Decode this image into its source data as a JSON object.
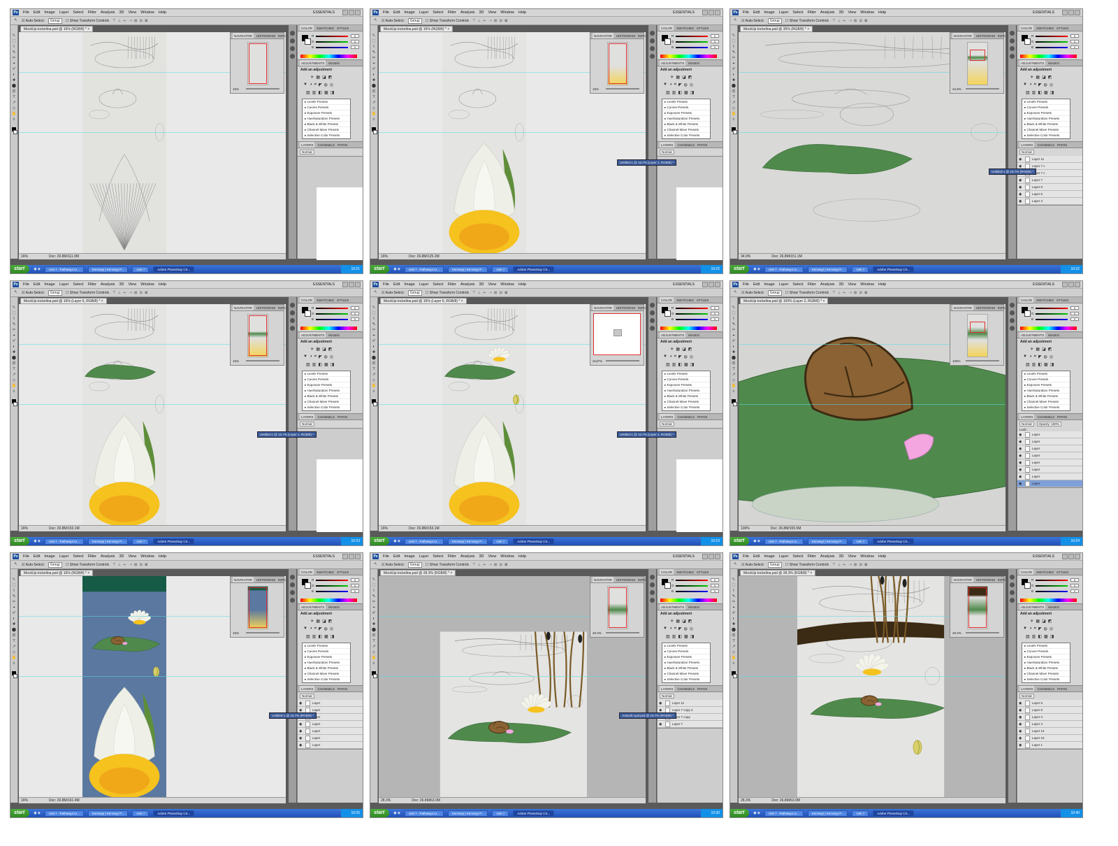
{
  "menu": [
    "File",
    "Edit",
    "Image",
    "Layer",
    "Select",
    "Filter",
    "Analysis",
    "3D",
    "View",
    "Window",
    "Help"
  ],
  "workspace": "ESSENTIALS",
  "options_bar": {
    "auto_select_label": "Auto-Select:",
    "auto_select_value": "Group",
    "show_transform_label": "Show Transform Controls"
  },
  "nav_tabs": [
    "NAVIGATOR",
    "HISTOGRAM",
    "INFO"
  ],
  "color_tabs": [
    "COLOR",
    "SWATCHES",
    "STYLES"
  ],
  "adj_tabs": [
    "ADJUSTMENTS",
    "MASKS"
  ],
  "adjustments_title": "Add an adjustment",
  "presets": [
    "Levels Presets",
    "Curves Presets",
    "Exposure Presets",
    "Hue/Saturation Presets",
    "Black & White Presets",
    "Channel Mixer Presets",
    "Selective Color Presets"
  ],
  "layers_tabs": [
    "LAYERS",
    "CHANNELS",
    "PATHS"
  ],
  "layers_mode": "Normal",
  "taskbar": {
    "start": "start",
    "buttons": [
      "Unit 7 - Pathways to...",
      "Kerrang! | Kerrang! P...",
      "Unit 7",
      "Adobe Photoshop CS..."
    ]
  },
  "colors": {
    "lily_pad": "#4f8a4c",
    "petal": "#f3f3ea",
    "flower_core": "#f5c21e",
    "water_blue": "#5a78a0",
    "dark_teal": "#175a45",
    "shell_brown": "#8a6233",
    "pink_tongue": "#f4a6e0",
    "taskbar_blue": "#2a5fc8"
  },
  "screens": [
    {
      "doc_tab": "MockUp-lockelloa.psd @ 16% (RGB/8) *",
      "status_zoom": "16%",
      "doc_size": "Doc: 26.8M/111.0M",
      "nav_zoom": "16%",
      "scene": "sketch-only",
      "clock": "10:21"
    },
    {
      "doc_tab": "MockUp-lockelloa.psd @ 16% (RGB/8) *",
      "status_zoom": "16%",
      "doc_size": "Doc: 26.8M/125.2M",
      "nav_zoom": "16%",
      "panel_window": "Untitled-1 @ 16.7% (Layer 1, RGB/8) *",
      "scene": "sketch-with-flower",
      "clock": "10:22"
    },
    {
      "doc_tab": "MockUp-lockelloa.psd @ 35% (RGB/8) *",
      "status_zoom": "34.9%",
      "doc_size": "Doc: 26.8M/151.1M",
      "nav_zoom": "34.9%",
      "panel_window": "Untitled-1 @ 16.7% (RGB/8) *",
      "layers": [
        "Layer 11",
        "Layer 7 c",
        "Layer 7 c",
        "Layer 7",
        "Layer 6",
        "Layer 5",
        "Layer 3"
      ],
      "scene": "zoom-lily-pad",
      "clock": "10:22"
    },
    {
      "doc_tab": "MockUp-lockelloa.psd @ 16% (Layer 6, RGB/8) *",
      "status_zoom": "16%",
      "doc_size": "Doc: 26.8M/153.1M",
      "nav_zoom": "16%",
      "panel_window": "Untitled-1 @ 16.7% (Layer 1, RGB/8) *",
      "scene": "pad-added",
      "clock": "10:23"
    },
    {
      "doc_tab": "MockUp-lockelloa.psd @ 16% (Layer 6, RGB/8) *",
      "status_zoom": "16%",
      "doc_size": "Doc: 26.8M/153.1M",
      "nav_zoom": "2137%",
      "panel_window": "Untitled-1 @ 16.7% (Layer 4, RGB/8) *",
      "scene": "pad-flower-bud",
      "clock": "10:23"
    },
    {
      "doc_tab": "MockUp-lockelloa.psd @ 100% (Layer 2, RGB/8) *",
      "status_zoom": "100%",
      "doc_size": "Doc: 26.8M/155.5M",
      "nav_zoom": "100%",
      "opacity": "Opacity: 100%",
      "lock": "Lock:",
      "layers": [
        "Layer",
        "Layer",
        "Layer",
        "Layer",
        "Layer",
        "Layer",
        "Layer",
        "Layer"
      ],
      "scene": "zoom-shell",
      "clock": "10:24"
    },
    {
      "doc_tab": "MockUp-lockelloa.psd @ 16% (RGB/8) *",
      "status_zoom": "16%",
      "doc_size": "Doc: 26.8M/161.4M",
      "nav_zoom": "16%",
      "panel_window": "Untitled-1 @ 16.7% (RGB/8) *",
      "layers": [
        "Layer",
        "Layer",
        "Layer",
        "Layer",
        "Layer",
        "Layer",
        "Layer"
      ],
      "scene": "water-bg",
      "clock": "10:25"
    },
    {
      "doc_tab": "MockUp-lockelloa.psd @ 28.3% (RGB/8) *",
      "status_zoom": "28.3%",
      "doc_size": "Doc: 26.8M/63.0M",
      "nav_zoom": "28.3%",
      "panel_window": "Artwork-cyal.psd @ 16.7% (RGB/8) *",
      "layers": [
        "Layer 11",
        "Layer 7 copy 2",
        "Layer 7 copy",
        "Layer 7"
      ],
      "scene": "reeds",
      "clock": "10:30"
    },
    {
      "doc_tab": "MockUp-lockelloa.psd @ 28.3% (RGB/8) *",
      "status_zoom": "28.3%",
      "doc_size": "Doc: 26.8M/63.0M",
      "nav_zoom": "28.3%",
      "layers": [
        "Layer 6",
        "Layer 5",
        "Layer 3",
        "Layer 4",
        "Layer 12",
        "Layer 10",
        "Layer 1"
      ],
      "scene": "branch-reeds",
      "clock": "10:40"
    }
  ]
}
